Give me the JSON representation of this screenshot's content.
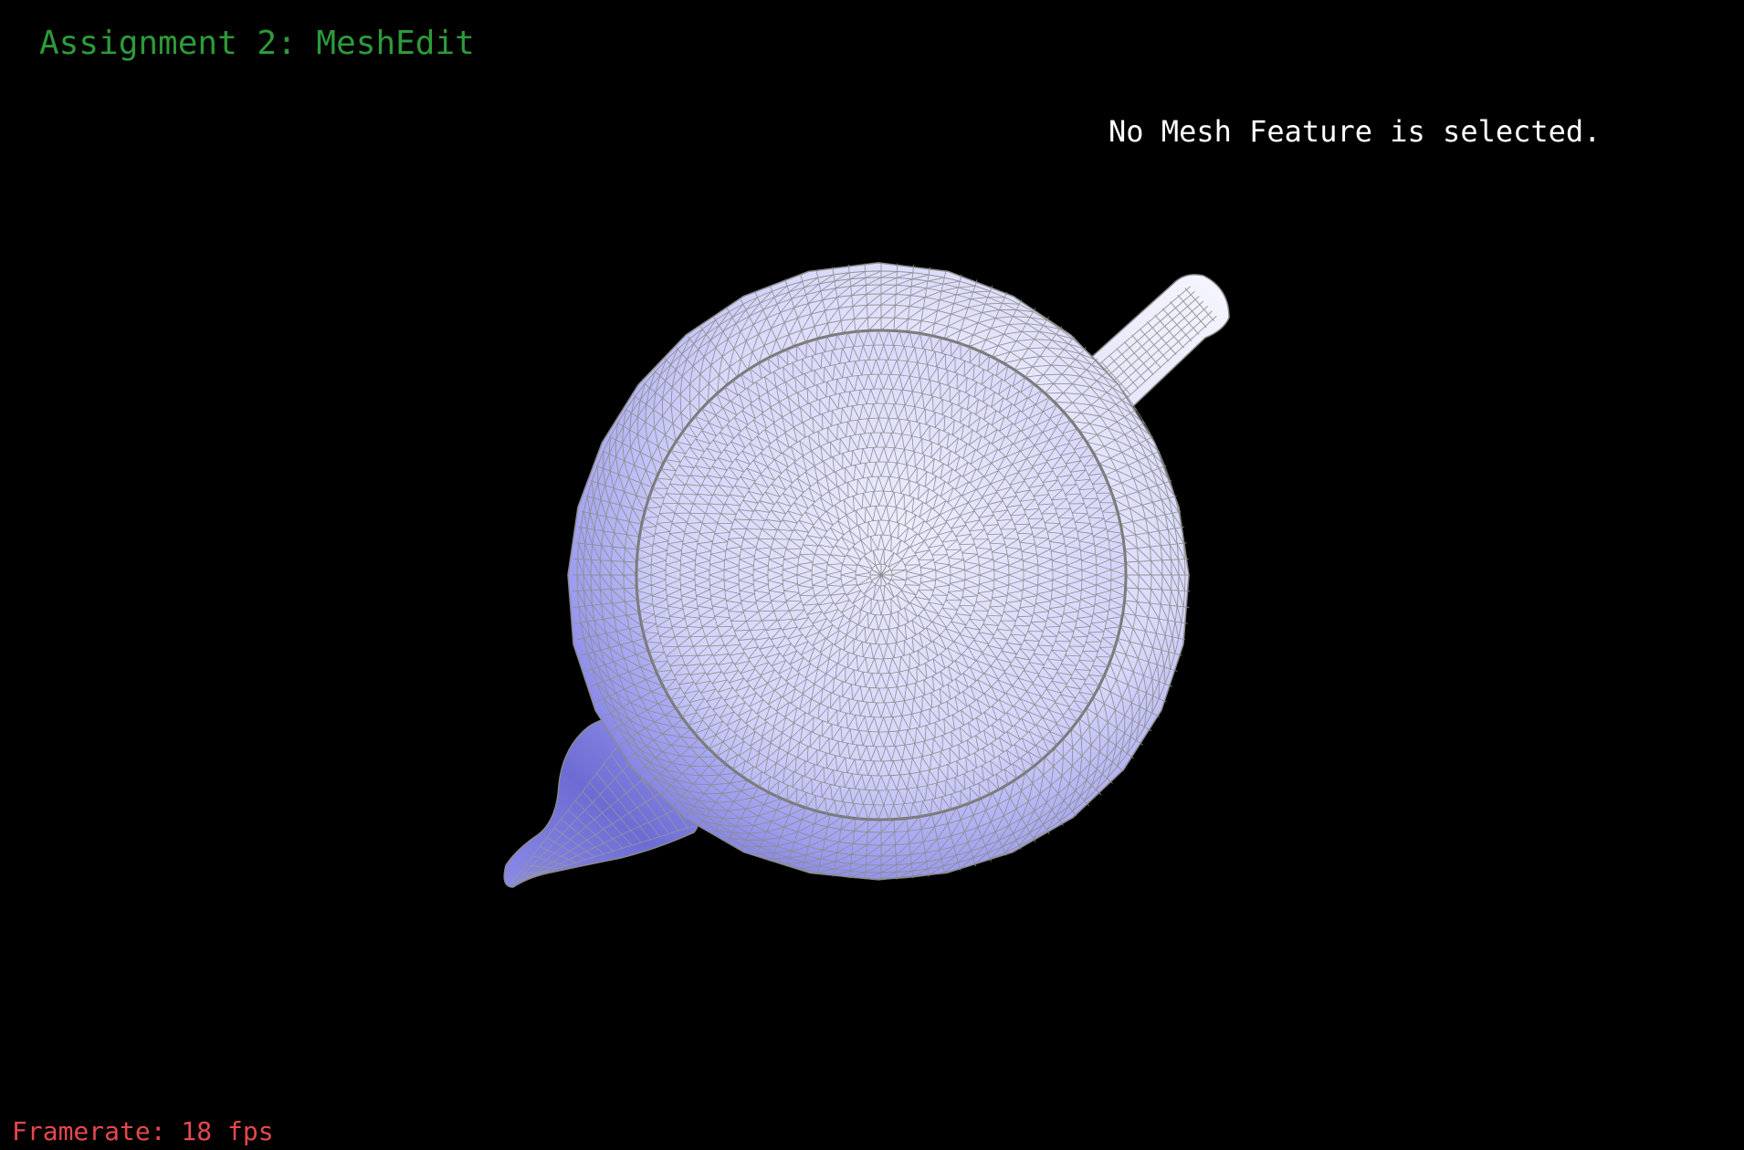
{
  "app": {
    "title": "Assignment 2: MeshEdit"
  },
  "selection": {
    "status": "No Mesh Feature is selected."
  },
  "stats": {
    "framerate_text": "Framerate: 18 fps"
  },
  "scene": {
    "model": "teapot",
    "render_mode": "shaded-wireframe",
    "view": "top-down"
  },
  "colors": {
    "background": "#000000",
    "title": "#2e9a3a",
    "status": "#ffffff",
    "framerate": "#e5484d",
    "mesh_fill_light": "#e8e8ff",
    "mesh_fill_dark": "#8080e8",
    "wireframe": "#8a8a8a"
  }
}
